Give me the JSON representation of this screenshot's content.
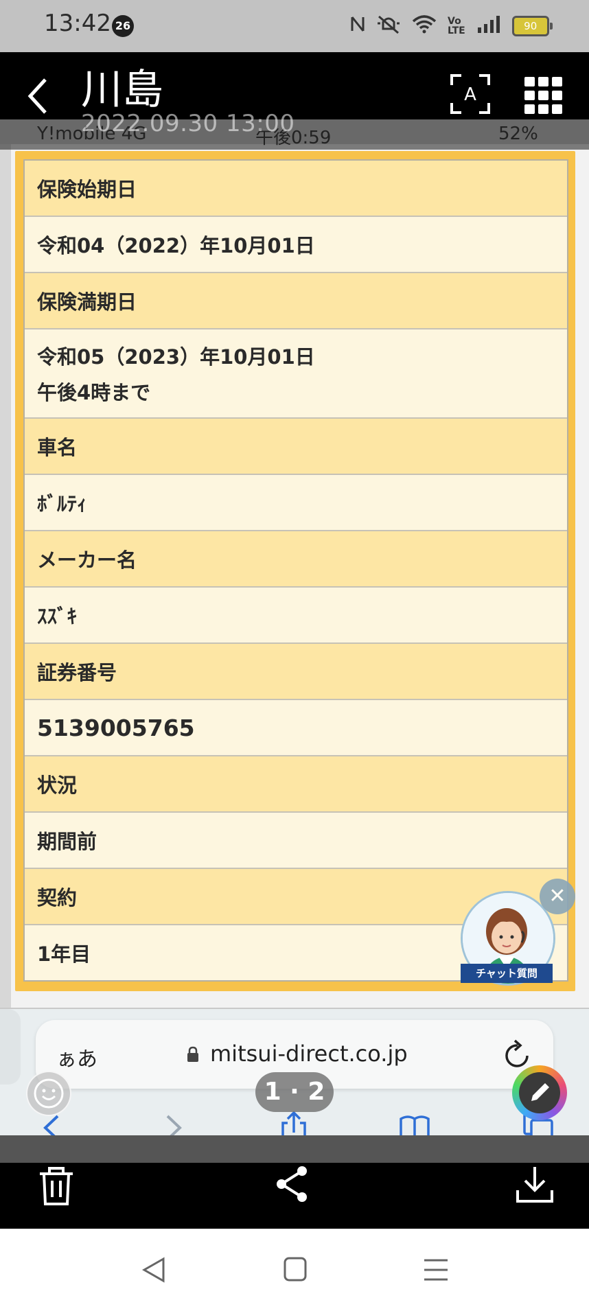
{
  "status_bar": {
    "time": "13:42",
    "notification_count": "26",
    "battery": "90"
  },
  "viewer": {
    "title": "川島",
    "date": "2022.09.30 13:00"
  },
  "screenshot": {
    "ios_status": {
      "carrier": "Y!mobile  4G",
      "time": "午後0:59",
      "battery": "52%"
    },
    "table_rows": [
      {
        "type": "header",
        "text": "保険始期日"
      },
      {
        "type": "value",
        "text": "令和04（2022）年10月01日"
      },
      {
        "type": "header",
        "text": "保険満期日"
      },
      {
        "type": "value",
        "text": "令和05（2023）年10月01日",
        "text2": "午後4時まで"
      },
      {
        "type": "header",
        "text": "車名"
      },
      {
        "type": "value",
        "text": "ﾎﾞﾙﾃｨ"
      },
      {
        "type": "header",
        "text": "メーカー名"
      },
      {
        "type": "value",
        "text": "ｽｽﾞｷ"
      },
      {
        "type": "header",
        "text": "証券番号"
      },
      {
        "type": "value",
        "text": "5139005765"
      },
      {
        "type": "header",
        "text": "状況"
      },
      {
        "type": "value",
        "text": "期間前"
      },
      {
        "type": "header",
        "text": "契約"
      },
      {
        "type": "value",
        "text": "1年目"
      }
    ],
    "chat_widget_label": "チャット質問",
    "safari": {
      "aa": "ぁあ",
      "url": "mitsui-direct.co.jp"
    },
    "page_indicator": "1 · 2"
  },
  "colors": {
    "table_border": "#f7c24a",
    "header_row": "#fde6a4",
    "value_row": "#fdf6df",
    "ios_blue": "#2f6fd6"
  }
}
